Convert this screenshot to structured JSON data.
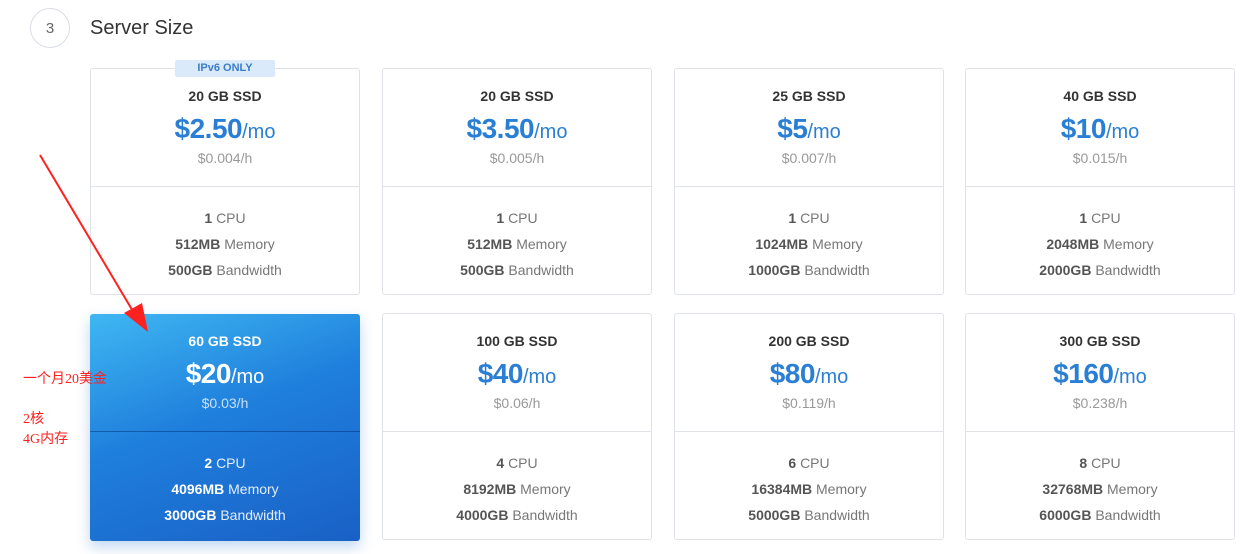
{
  "section": {
    "step_number": "3",
    "title": "Server Size"
  },
  "plans": [
    {
      "badge": "IPv6 ONLY",
      "ssd": "20 GB SSD",
      "price": "$2.50",
      "unit": "/mo",
      "hourly": "$0.004/h",
      "cpu_num": "1",
      "cpu_label": "CPU",
      "mem_num": "512MB",
      "mem_label": "Memory",
      "bw_num": "500GB",
      "bw_label": "Bandwidth",
      "selected": false
    },
    {
      "ssd": "20 GB SSD",
      "price": "$3.50",
      "unit": "/mo",
      "hourly": "$0.005/h",
      "cpu_num": "1",
      "cpu_label": "CPU",
      "mem_num": "512MB",
      "mem_label": "Memory",
      "bw_num": "500GB",
      "bw_label": "Bandwidth",
      "selected": false
    },
    {
      "ssd": "25 GB SSD",
      "price": "$5",
      "unit": "/mo",
      "hourly": "$0.007/h",
      "cpu_num": "1",
      "cpu_label": "CPU",
      "mem_num": "1024MB",
      "mem_label": "Memory",
      "bw_num": "1000GB",
      "bw_label": "Bandwidth",
      "selected": false
    },
    {
      "ssd": "40 GB SSD",
      "price": "$10",
      "unit": "/mo",
      "hourly": "$0.015/h",
      "cpu_num": "1",
      "cpu_label": "CPU",
      "mem_num": "2048MB",
      "mem_label": "Memory",
      "bw_num": "2000GB",
      "bw_label": "Bandwidth",
      "selected": false
    },
    {
      "ssd": "60 GB SSD",
      "price": "$20",
      "unit": "/mo",
      "hourly": "$0.03/h",
      "cpu_num": "2",
      "cpu_label": "CPU",
      "mem_num": "4096MB",
      "mem_label": "Memory",
      "bw_num": "3000GB",
      "bw_label": "Bandwidth",
      "selected": true
    },
    {
      "ssd": "100 GB SSD",
      "price": "$40",
      "unit": "/mo",
      "hourly": "$0.06/h",
      "cpu_num": "4",
      "cpu_label": "CPU",
      "mem_num": "8192MB",
      "mem_label": "Memory",
      "bw_num": "4000GB",
      "bw_label": "Bandwidth",
      "selected": false
    },
    {
      "ssd": "200 GB SSD",
      "price": "$80",
      "unit": "/mo",
      "hourly": "$0.119/h",
      "cpu_num": "6",
      "cpu_label": "CPU",
      "mem_num": "16384MB",
      "mem_label": "Memory",
      "bw_num": "5000GB",
      "bw_label": "Bandwidth",
      "selected": false
    },
    {
      "ssd": "300 GB SSD",
      "price": "$160",
      "unit": "/mo",
      "hourly": "$0.238/h",
      "cpu_num": "8",
      "cpu_label": "CPU",
      "mem_num": "32768MB",
      "mem_label": "Memory",
      "bw_num": "6000GB",
      "bw_label": "Bandwidth",
      "selected": false
    }
  ],
  "annotations": {
    "note_price": "一个月20美金",
    "note_cores": "2核",
    "note_memory": "4G内存",
    "color": "#ff2020"
  },
  "colors": {
    "accent": "#2a7fd4",
    "selected_start": "#3fb7f2",
    "selected_end": "#1960c5"
  }
}
